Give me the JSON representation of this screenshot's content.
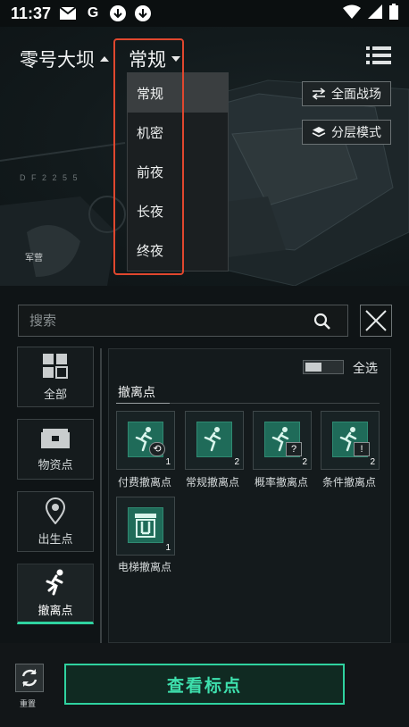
{
  "status_bar": {
    "time": "11:37",
    "icons": [
      "gmail-icon",
      "google-icon",
      "download-icon",
      "download-icon",
      "wifi-icon",
      "signal-icon",
      "battery-icon"
    ]
  },
  "header": {
    "map_name": "零号大坝",
    "mode": "常规"
  },
  "mode_dropdown": {
    "options": [
      "常规",
      "机密",
      "前夜",
      "长夜",
      "终夜"
    ],
    "selected": "常规"
  },
  "map_buttons": {
    "full_battlefield": "全面战场",
    "layer_mode": "分层模式"
  },
  "map_labels": {
    "barracks": "军营",
    "code": "D F 2 2 5 5"
  },
  "search": {
    "placeholder": "搜索"
  },
  "categories": [
    {
      "label": "全部"
    },
    {
      "label": "物资点"
    },
    {
      "label": "出生点"
    },
    {
      "label": "撤离点"
    }
  ],
  "panel": {
    "select_all": "全选",
    "section_title": "撤离点",
    "items": [
      {
        "label": "付费撤离点",
        "count": "1",
        "badge": "⟲"
      },
      {
        "label": "常规撤离点",
        "count": "2",
        "badge": ""
      },
      {
        "label": "概率撤离点",
        "count": "2",
        "badge": "?"
      },
      {
        "label": "条件撤离点",
        "count": "2",
        "badge": "!"
      },
      {
        "label": "电梯撤离点",
        "count": "1",
        "badge": ""
      }
    ]
  },
  "bottom": {
    "reset_label": "重置",
    "view_button": "查看标点"
  },
  "colors": {
    "accent": "#2fd3a0",
    "highlight_outline": "#e0472e",
    "tile_icon": "#1f6b59"
  }
}
